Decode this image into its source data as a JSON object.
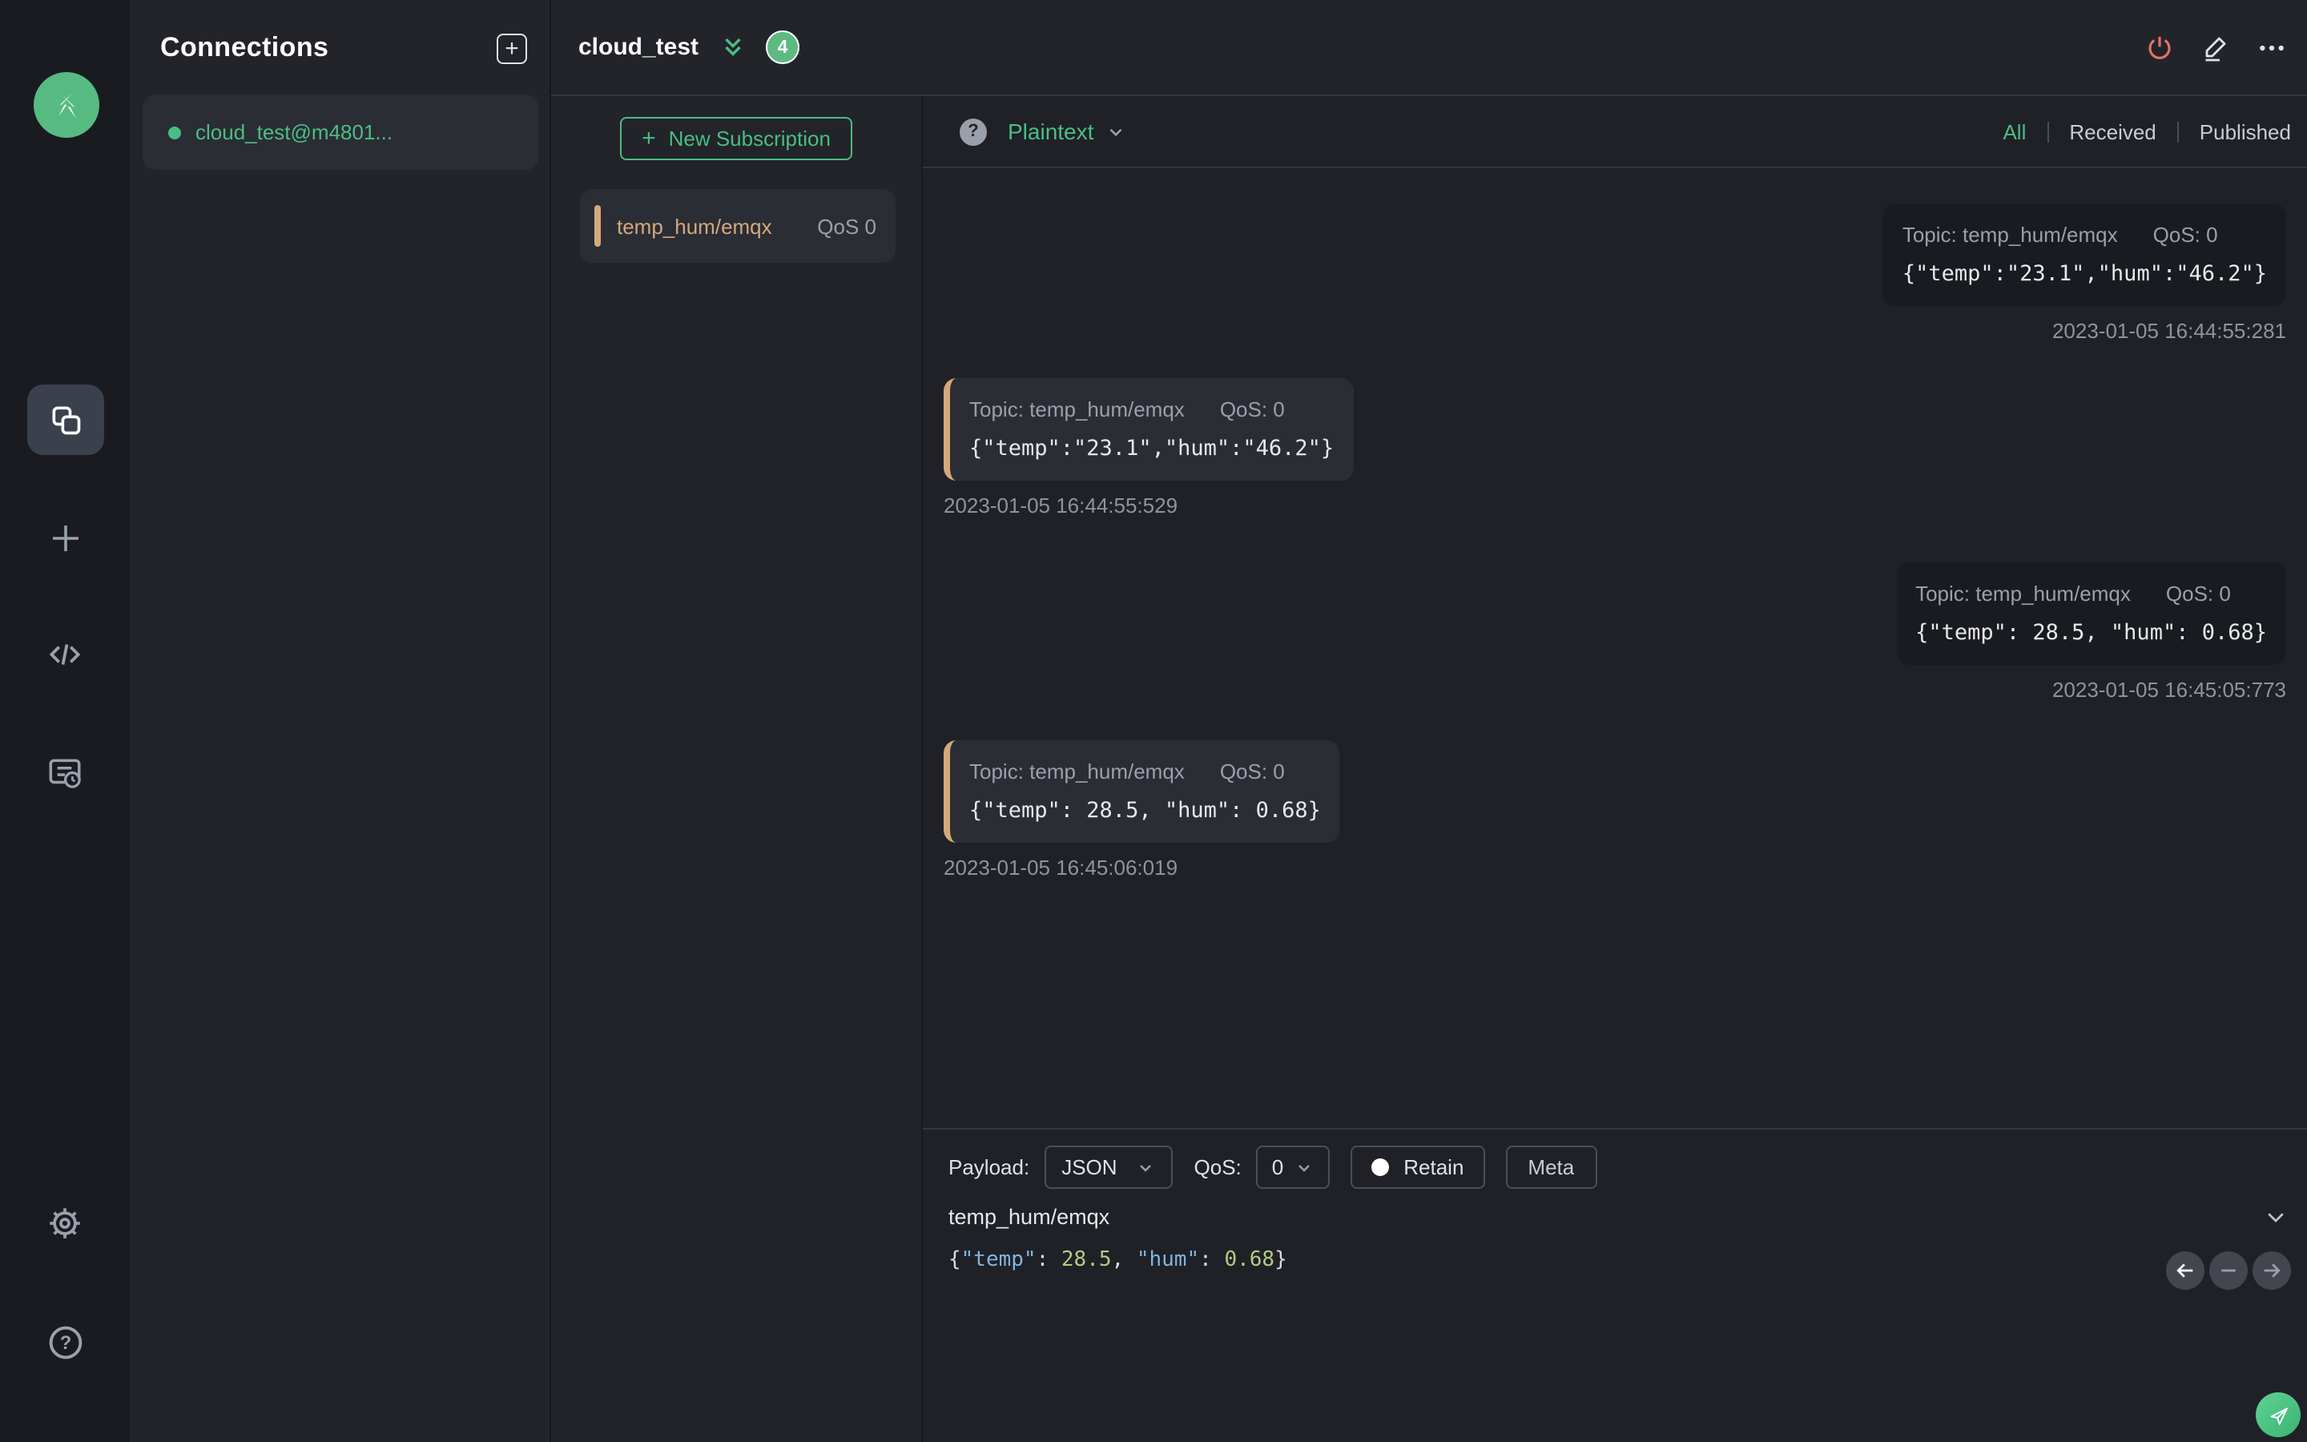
{
  "colors": {
    "accent_green": "#47bd87",
    "danger_red": "#e4706a",
    "topic_tan": "#d4a87c",
    "json_key_blue": "#82b4dd",
    "json_num_green": "#b2cb83"
  },
  "connections_panel": {
    "title": "Connections",
    "items": [
      {
        "name": "cloud_test@m4801...",
        "status": "connected"
      }
    ]
  },
  "header": {
    "title": "cloud_test",
    "message_count_badge": "4"
  },
  "subscriptions": {
    "new_button_label": "New Subscription",
    "items": [
      {
        "topic": "temp_hum/emqx",
        "qos": "QoS 0"
      }
    ]
  },
  "messages_toolbar": {
    "format": "Plaintext",
    "filters": {
      "all": "All",
      "received": "Received",
      "published": "Published"
    },
    "active_filter": "All"
  },
  "messages": [
    {
      "direction": "published",
      "topic_label": "Topic: temp_hum/emqx",
      "qos_label": "QoS: 0",
      "payload": "{\"temp\":\"23.1\",\"hum\":\"46.2\"}",
      "timestamp": "2023-01-05 16:44:55:281"
    },
    {
      "direction": "received",
      "topic_label": "Topic: temp_hum/emqx",
      "qos_label": "QoS: 0",
      "payload": "{\"temp\":\"23.1\",\"hum\":\"46.2\"}",
      "timestamp": "2023-01-05 16:44:55:529"
    },
    {
      "direction": "published",
      "topic_label": "Topic: temp_hum/emqx",
      "qos_label": "QoS: 0",
      "payload": "{\"temp\": 28.5, \"hum\": 0.68}",
      "timestamp": "2023-01-05 16:45:05:773"
    },
    {
      "direction": "received",
      "topic_label": "Topic: temp_hum/emqx",
      "qos_label": "QoS: 0",
      "payload": "{\"temp\": 28.5, \"hum\": 0.68}",
      "timestamp": "2023-01-05 16:45:06:019"
    }
  ],
  "publish": {
    "payload_label": "Payload:",
    "payload_type": "JSON",
    "qos_label": "QoS:",
    "qos_value": "0",
    "retain_label": "Retain",
    "meta_label": "Meta",
    "topic": "temp_hum/emqx",
    "payload_tokens": {
      "open": "{",
      "key1": "\"temp\"",
      "sep1": ": ",
      "num1": "28.5",
      "comma": ", ",
      "key2": "\"hum\"",
      "sep2": ": ",
      "num2": "0.68",
      "close": "}"
    }
  }
}
